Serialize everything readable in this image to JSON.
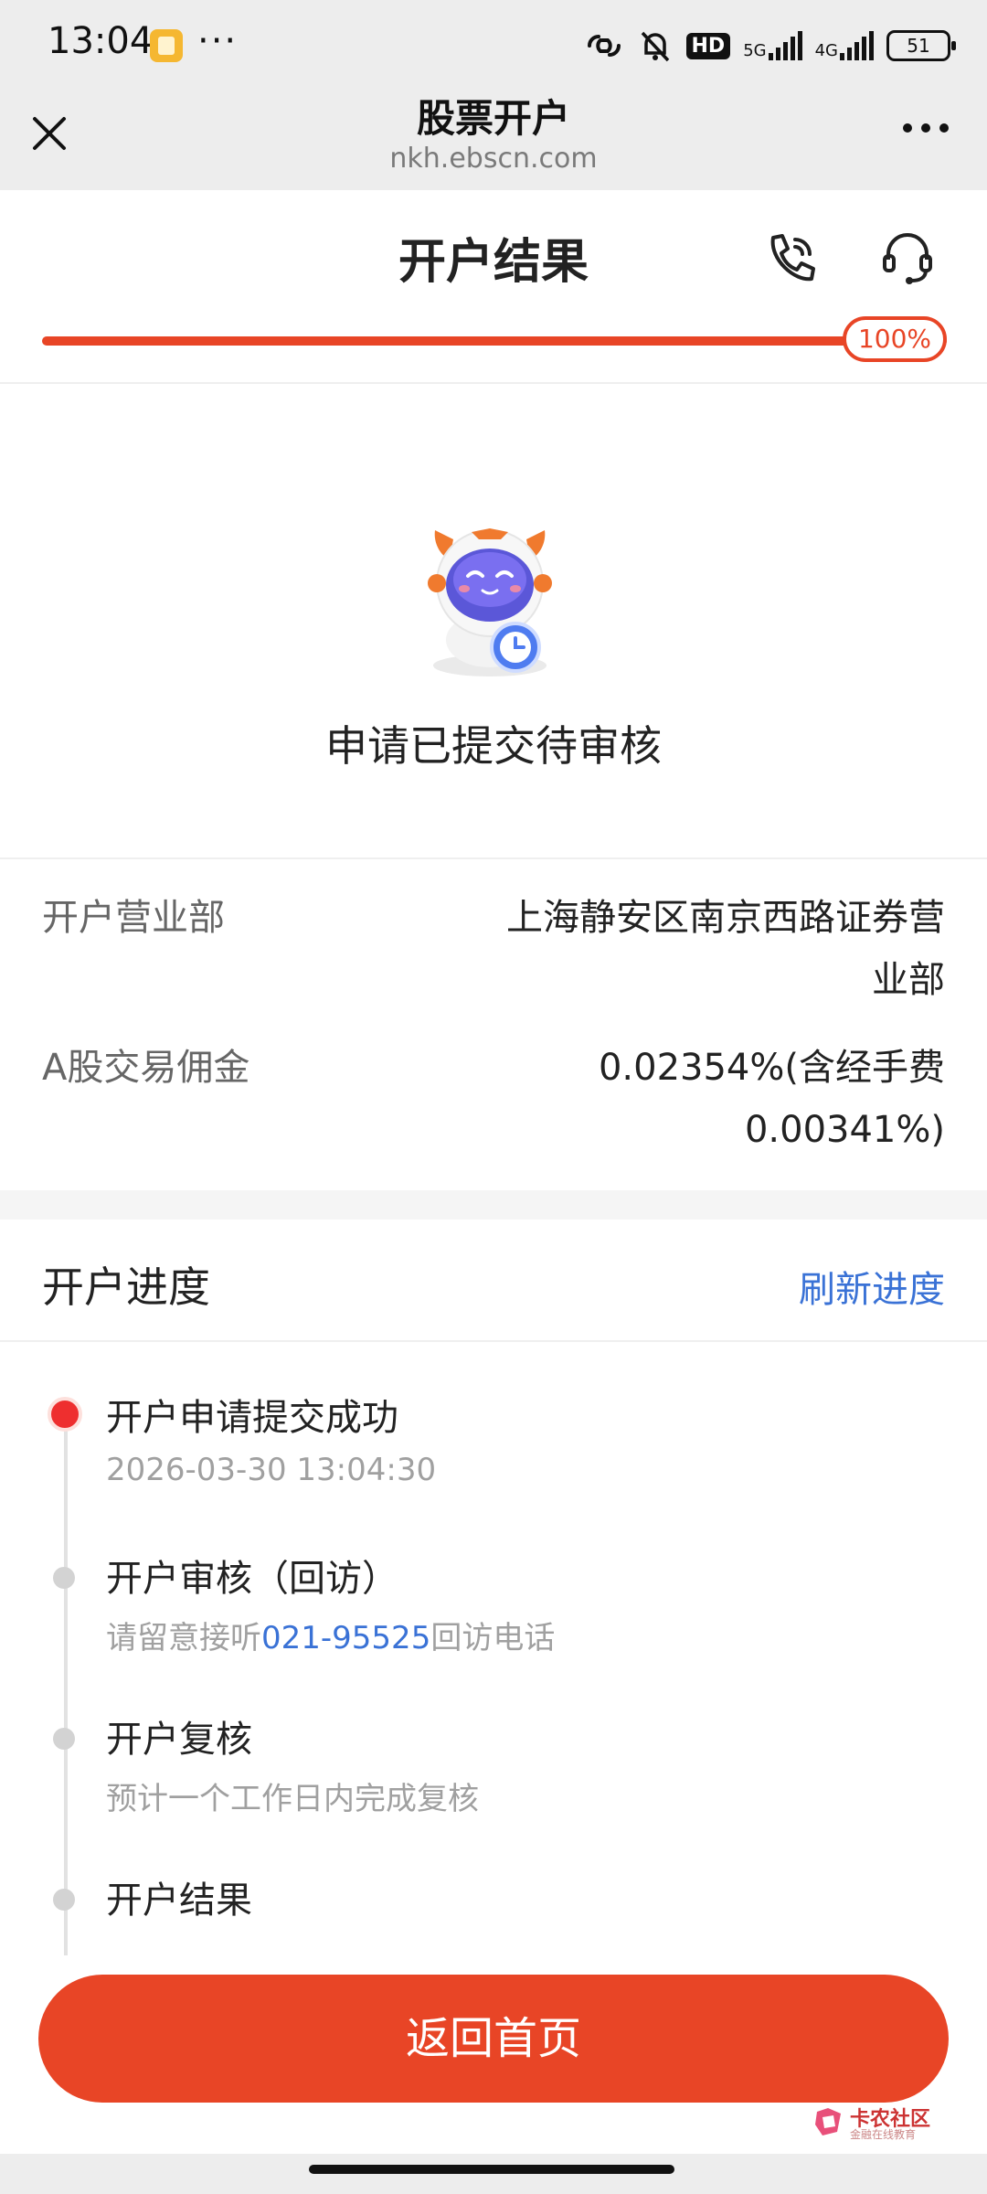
{
  "status_bar": {
    "time": "13:04",
    "dots": "···",
    "hd_label": "HD",
    "net1_label": "5G",
    "net2_label": "4G",
    "battery": "51"
  },
  "nav": {
    "title": "股票开户",
    "url": "nkh.ebscn.com"
  },
  "header": {
    "title": "开户结果",
    "progress_fraction": 1.0,
    "progress_label": "100%"
  },
  "result": {
    "status_text": "申请已提交待审核"
  },
  "info": {
    "rows": [
      {
        "label": "开户营业部",
        "value": "上海静安区南京西路证券营业部"
      },
      {
        "label": "A股交易佣金",
        "value": "0.02354%(含经手费0.00341%)"
      }
    ]
  },
  "progress_section": {
    "title": "开户进度",
    "refresh_label": "刷新进度",
    "steps": [
      {
        "title": "开户申请提交成功",
        "sub": "2026-03-30 13:04:30"
      },
      {
        "title": "开户审核（回访）",
        "sub_prefix": "请留意接听",
        "sub_link": "021-95525",
        "sub_suffix": "回访电话"
      },
      {
        "title": "开户复核",
        "sub": "预计一个工作日内完成复核"
      },
      {
        "title": "开户结果"
      }
    ]
  },
  "footer": {
    "home_button": "返回首页"
  },
  "watermark": {
    "text": "卡农社区",
    "sub": "金融在线教育"
  },
  "colors": {
    "accent": "#e84526",
    "link": "#3a72d6",
    "active_dot": "#ee2f2f"
  }
}
